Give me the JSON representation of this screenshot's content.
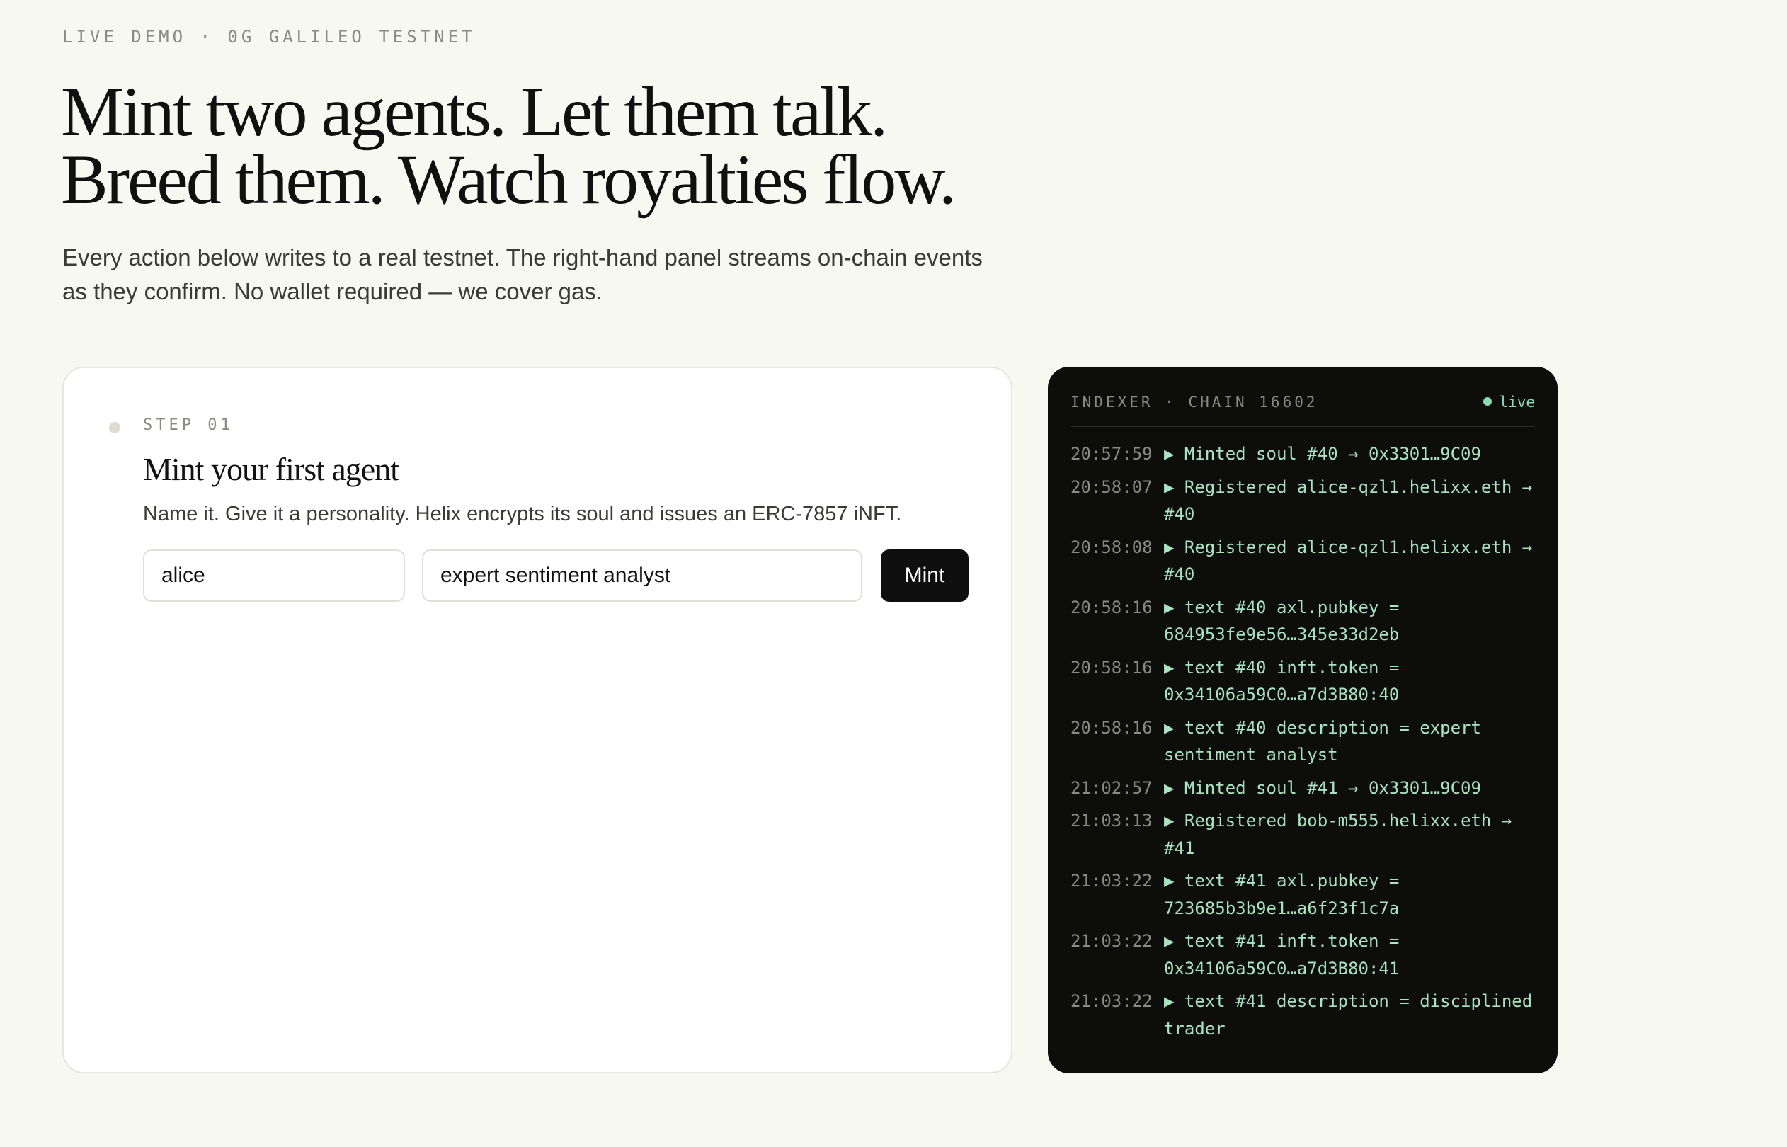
{
  "eyebrow": "LIVE DEMO · 0G GALILEO TESTNET",
  "headline": "Mint two agents. Let them talk. Breed them. Watch royalties flow.",
  "subhead": "Every action below writes to a real testnet. The right-hand panel streams on-chain events as they confirm. No wallet required — we cover gas.",
  "step": {
    "label": "STEP 01",
    "title": "Mint your first agent",
    "description": "Name it. Give it a personality. Helix encrypts its soul and issues an ERC-7857 iNFT.",
    "name_value": "alice",
    "personality_value": "expert sentiment analyst",
    "mint_label": "Mint"
  },
  "indexer": {
    "title": "INDEXER · CHAIN 16602",
    "status": "live",
    "accent_color": "#a9e3c2",
    "events": [
      {
        "time": "20:57:59",
        "message": "▶ Minted soul #40 → 0x3301…9C09"
      },
      {
        "time": "20:58:07",
        "message": "▶ Registered alice-qzl1.helixx.eth → #40"
      },
      {
        "time": "20:58:08",
        "message": "▶ Registered alice-qzl1.helixx.eth → #40"
      },
      {
        "time": "20:58:16",
        "message": "▶ text #40 axl.pubkey = 684953fe9e56…345e33d2eb"
      },
      {
        "time": "20:58:16",
        "message": "▶ text #40 inft.token = 0x34106a59C0…a7d3B80:40"
      },
      {
        "time": "20:58:16",
        "message": "▶ text #40 description = expert sentiment analyst"
      },
      {
        "time": "21:02:57",
        "message": "▶ Minted soul #41 → 0x3301…9C09"
      },
      {
        "time": "21:03:13",
        "message": "▶ Registered bob-m555.helixx.eth → #41"
      },
      {
        "time": "21:03:22",
        "message": "▶ text #41 axl.pubkey = 723685b3b9e1…a6f23f1c7a"
      },
      {
        "time": "21:03:22",
        "message": "▶ text #41 inft.token = 0x34106a59C0…a7d3B80:41"
      },
      {
        "time": "21:03:22",
        "message": "▶ text #41 description = disciplined trader"
      }
    ]
  }
}
